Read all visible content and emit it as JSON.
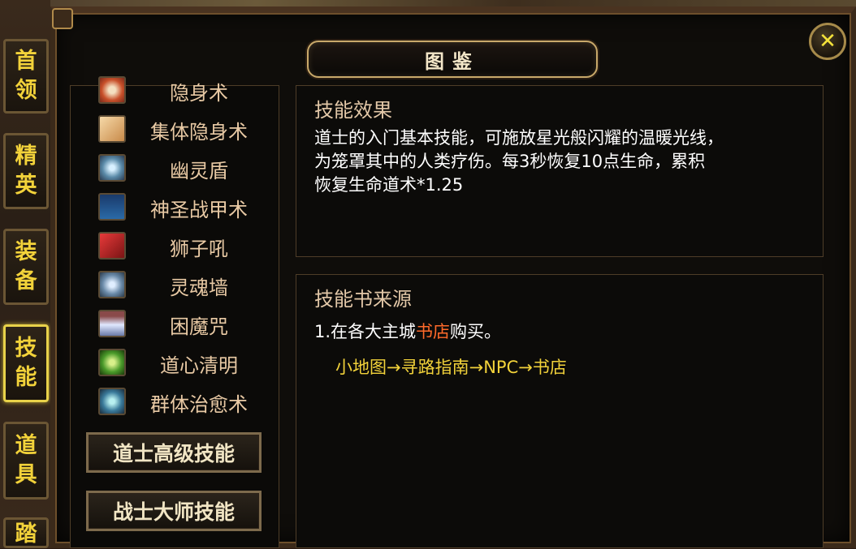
{
  "window": {
    "title": "图鉴",
    "close_symbol": "✕"
  },
  "side_tabs": [
    {
      "label_top": "首",
      "label_bottom": "领",
      "active": false
    },
    {
      "label_top": "精",
      "label_bottom": "英",
      "active": false
    },
    {
      "label_top": "装",
      "label_bottom": "备",
      "active": false
    },
    {
      "label_top": "技",
      "label_bottom": "能",
      "active": true
    },
    {
      "label_top": "道",
      "label_bottom": "具",
      "active": false
    },
    {
      "label_top": "踏",
      "label_bottom": "",
      "active": false
    }
  ],
  "skill_list": [
    {
      "name": "隐身术",
      "icon": "stealth-ring-icon"
    },
    {
      "name": "集体隐身术",
      "icon": "group-stealth-icon"
    },
    {
      "name": "幽灵盾",
      "icon": "ghost-shield-icon"
    },
    {
      "name": "神圣战甲术",
      "icon": "holy-armor-icon"
    },
    {
      "name": "狮子吼",
      "icon": "lion-roar-icon"
    },
    {
      "name": "灵魂墙",
      "icon": "soul-wall-icon"
    },
    {
      "name": "困魔咒",
      "icon": "trap-curse-icon"
    },
    {
      "name": "道心清明",
      "icon": "yin-yang-icon"
    },
    {
      "name": "群体治愈术",
      "icon": "group-heal-icon"
    }
  ],
  "category_buttons": [
    "道士高级技能",
    "战士大师技能"
  ],
  "effect_panel": {
    "heading": "技能效果",
    "lines": [
      "道士的入门基本技能，可施放星光般闪耀的温暖光线，",
      "为笼罩其中的人类疗伤。每3秒恢复10点生命，累积",
      "恢复生命道术*1.25"
    ]
  },
  "source_panel": {
    "heading": "技能书来源",
    "line_prefix": "1.在各大主城",
    "line_shop": "书店",
    "line_suffix": "购买。",
    "path": "小地图→寻路指南→NPC→书店"
  }
}
